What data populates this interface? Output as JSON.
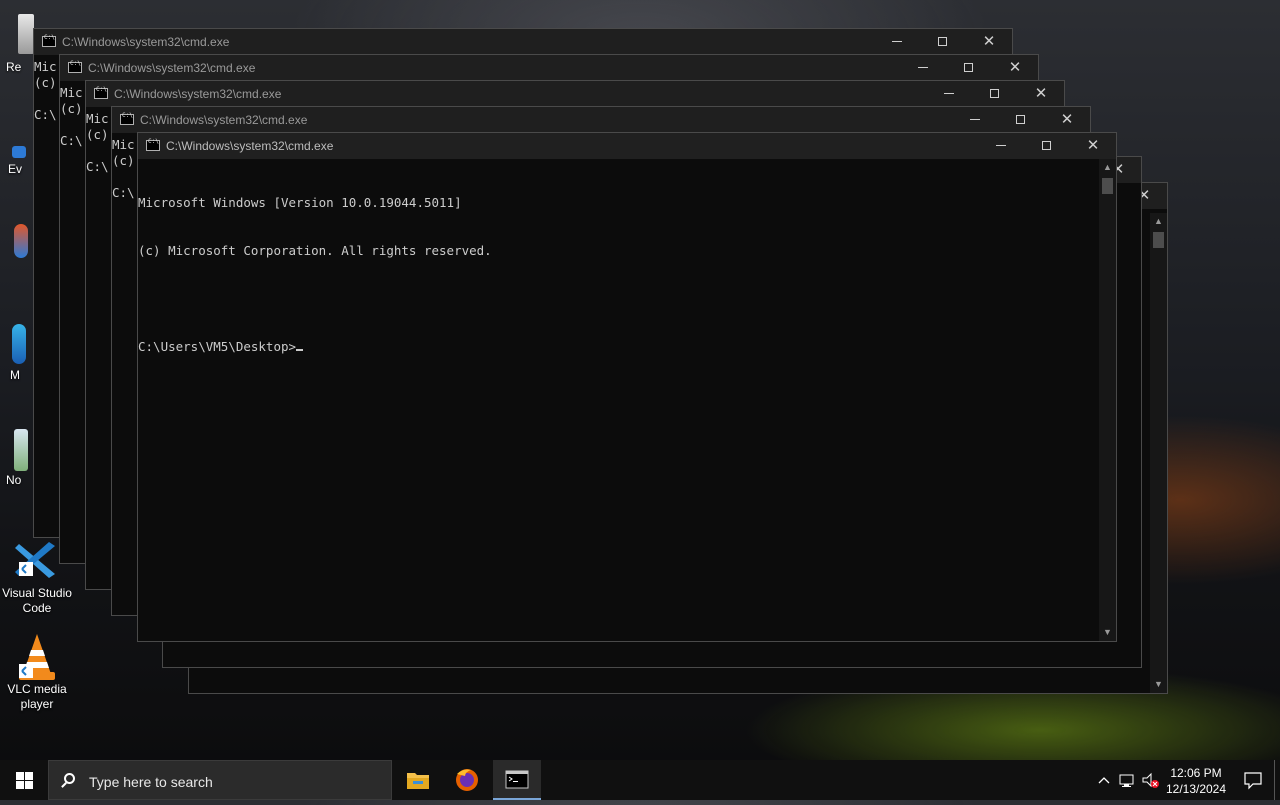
{
  "desktop": {
    "icons": [
      {
        "label_line1": "Visual Studio",
        "label_line2": "Code"
      },
      {
        "label_line1": "VLC media",
        "label_line2": "player"
      }
    ],
    "partial_labels": [
      "Re",
      "Ev",
      "M",
      "No"
    ]
  },
  "windows": [
    {
      "title": "C:\\Windows\\system32\\cmd.exe",
      "peek_line1": "Mic",
      "peek_line2": "(c)",
      "peek_line3": "C:\\"
    },
    {
      "title": "C:\\Windows\\system32\\cmd.exe",
      "peek_line1": "Mic",
      "peek_line2": "(c)",
      "peek_line3": "C:\\"
    },
    {
      "title": "C:\\Windows\\system32\\cmd.exe",
      "peek_line1": "Mic",
      "peek_line2": "(c)",
      "peek_line3": "C:\\"
    },
    {
      "title": "C:\\Windows\\system32\\cmd.exe",
      "peek_line1": "Mic",
      "peek_line2": "(c)",
      "peek_line3": "C:\\"
    },
    {
      "title": "C:\\Windows\\system32\\cmd.exe"
    }
  ],
  "active_console": {
    "line1": "Microsoft Windows [Version 10.0.19044.5011]",
    "line2": "(c) Microsoft Corporation. All rights reserved.",
    "prompt": "C:\\Users\\VM5\\Desktop>"
  },
  "window_controls": {
    "minimize": "—",
    "maximize": "☐",
    "close": "✕"
  },
  "taskbar": {
    "search_placeholder": "Type here to search",
    "apps": [
      "file-explorer",
      "firefox",
      "command-prompt"
    ],
    "time": "12:06 PM",
    "date": "12/13/2024"
  }
}
